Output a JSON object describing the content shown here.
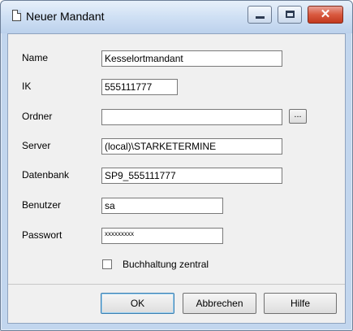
{
  "window": {
    "title": "Neuer Mandant"
  },
  "form": {
    "name_label": "Name",
    "name_value": "Kesselortmandant",
    "ik_label": "IK",
    "ik_value": "555111777",
    "ordner_label": "Ordner",
    "ordner_value": "",
    "browse_label": "...",
    "server_label": "Server",
    "server_value": "(local)\\STARKETERMINE",
    "datenbank_label": "Datenbank",
    "datenbank_value": "SP9_555111777",
    "benutzer_label": "Benutzer",
    "benutzer_value": "sa",
    "passwort_label": "Passwort",
    "passwort_value": "xxxxxxxxx",
    "checkbox_label": "Buchhaltung zentral",
    "checkbox_checked": false
  },
  "buttons": {
    "ok": "OK",
    "cancel": "Abbrechen",
    "help": "Hilfe"
  },
  "colors": {
    "titlebar": "#cfe0f4",
    "close": "#d9593f",
    "dialog_bg": "#f0f0f0"
  }
}
